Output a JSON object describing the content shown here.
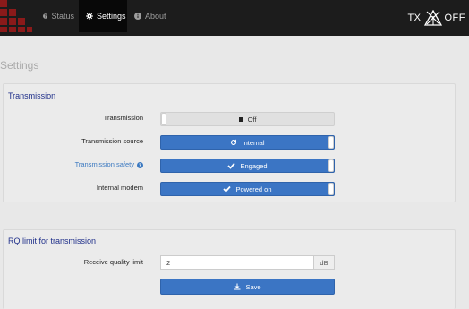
{
  "navbar": {
    "tabs": [
      {
        "label": "Status",
        "icon": "question-circle-icon"
      },
      {
        "label": "Settings",
        "icon": "gear-icon"
      },
      {
        "label": "About",
        "icon": "info-circle-icon"
      }
    ],
    "active_tab": "Settings",
    "tx_label": "TX",
    "tx_state": "OFF"
  },
  "page_title": "Settings",
  "transmission_panel": {
    "heading": "Transmission",
    "rows": [
      {
        "label": "Transmission",
        "value": "Off",
        "icon": "stop-square-icon",
        "state": "off"
      },
      {
        "label": "Transmission source",
        "value": "Internal",
        "icon": "refresh-icon",
        "state": "on"
      },
      {
        "label": "Transmission safety",
        "value": "Engaged",
        "icon": "check-icon",
        "state": "on",
        "help_icon": "question-circle-icon"
      },
      {
        "label": "Internal modem",
        "value": "Powered on",
        "icon": "check-icon",
        "state": "on"
      }
    ]
  },
  "rq_panel": {
    "heading": "RQ limit for transmission",
    "field_label": "Receive quality limit",
    "field_value": "2",
    "unit": "dB",
    "save_label": "Save",
    "save_icon": "download-icon"
  },
  "colors": {
    "navbar_bg": "#1c1c1c",
    "accent_blue": "#3b75c4",
    "heading_blue": "#1f2f8a",
    "logo_red": "#8b1a1a"
  }
}
